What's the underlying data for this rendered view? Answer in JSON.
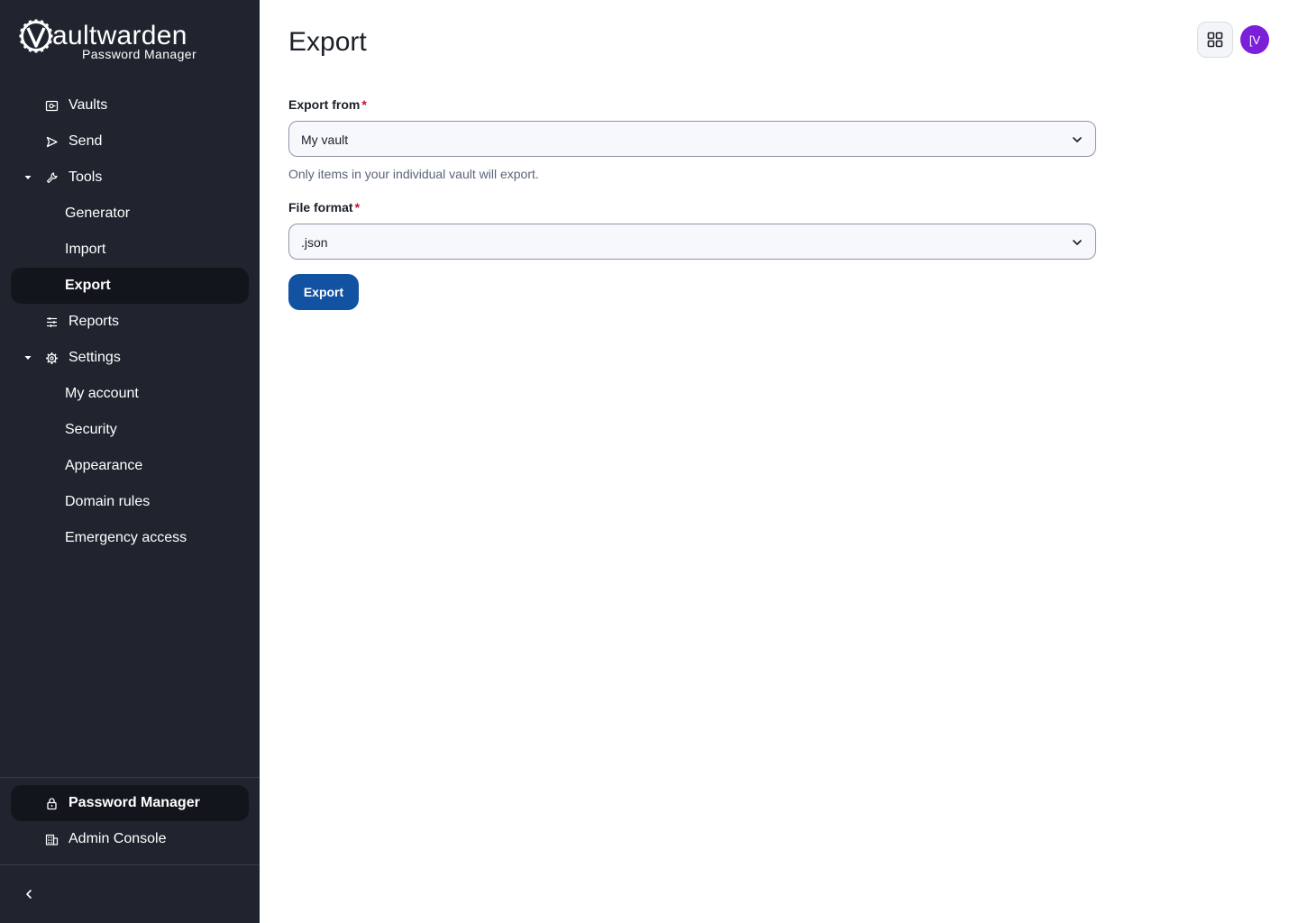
{
  "brand": {
    "name_bold": "V",
    "name_rest": "aultwarden",
    "subtitle": "Password Manager"
  },
  "sidebar": {
    "items": [
      {
        "label": "Vaults",
        "icon": "vault-icon"
      },
      {
        "label": "Send",
        "icon": "send-icon"
      },
      {
        "label": "Tools",
        "icon": "wrench-icon",
        "expanded": true
      },
      {
        "label": "Generator"
      },
      {
        "label": "Import"
      },
      {
        "label": "Export",
        "active": true
      },
      {
        "label": "Reports",
        "icon": "sliders-icon"
      },
      {
        "label": "Settings",
        "icon": "gear-icon",
        "expanded": true
      },
      {
        "label": "My account"
      },
      {
        "label": "Security"
      },
      {
        "label": "Appearance"
      },
      {
        "label": "Domain rules"
      },
      {
        "label": "Emergency access"
      }
    ],
    "product_switcher": [
      {
        "label": "Password Manager",
        "icon": "lock-icon",
        "active": true
      },
      {
        "label": "Admin Console",
        "icon": "building-icon"
      }
    ]
  },
  "header": {
    "title": "Export",
    "avatar_initials": "[V"
  },
  "form": {
    "export_from": {
      "label": "Export from",
      "required_mark": "*",
      "value": "My vault",
      "hint": "Only items in your individual vault will export."
    },
    "file_format": {
      "label": "File format",
      "required_mark": "*",
      "value": ".json"
    },
    "submit_label": "Export"
  },
  "colors": {
    "sidebar_bg": "#1f242e",
    "active_item_bg": "#12151c",
    "primary_button": "#1252a3",
    "avatar_bg": "#7b1fd8",
    "required": "#c8102e"
  }
}
